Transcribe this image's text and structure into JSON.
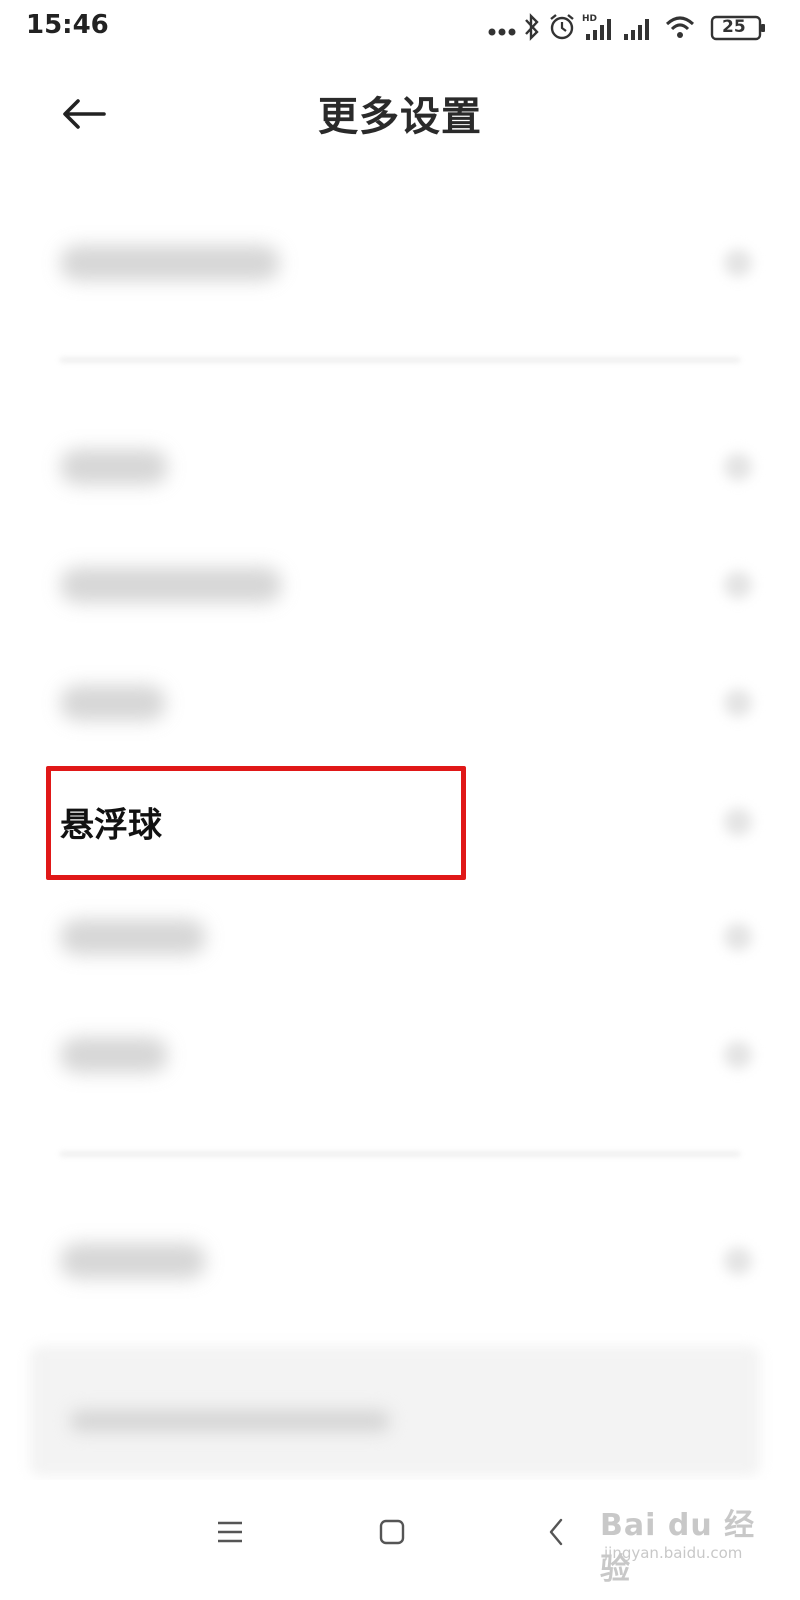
{
  "status_bar": {
    "time": "15:46",
    "battery_level": "25",
    "icons": [
      "more-dots-icon",
      "bluetooth-icon",
      "alarm-icon",
      "hd-signal-icon",
      "signal-icon",
      "wifi-icon",
      "battery-icon"
    ]
  },
  "header": {
    "title": "更多设置",
    "back_icon": "back-arrow-icon"
  },
  "list": {
    "highlighted_item": {
      "label": "悬浮球",
      "highlight_color": "#e01818"
    }
  },
  "nav_bar": {
    "icons": [
      "menu-icon",
      "home-icon",
      "back-icon"
    ]
  },
  "watermark": {
    "logo": "Bai du 经验",
    "sub": "jingyan.baidu.com"
  }
}
